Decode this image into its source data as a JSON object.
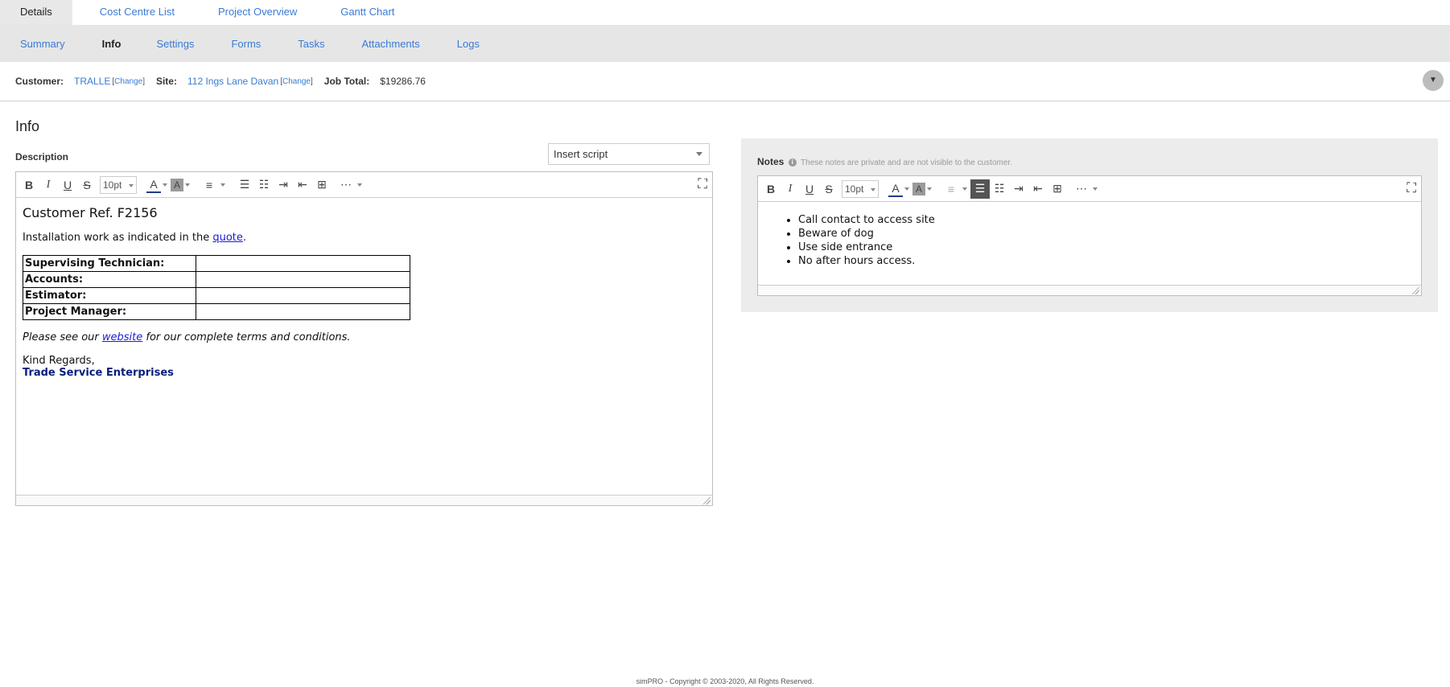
{
  "top_tabs": [
    {
      "label": "Details",
      "active": true
    },
    {
      "label": "Cost Centre List"
    },
    {
      "label": "Project Overview"
    },
    {
      "label": "Gantt Chart"
    }
  ],
  "sub_tabs": [
    {
      "label": "Summary"
    },
    {
      "label": "Info",
      "active": true
    },
    {
      "label": "Settings"
    },
    {
      "label": "Forms"
    },
    {
      "label": "Tasks"
    },
    {
      "label": "Attachments"
    },
    {
      "label": "Logs"
    }
  ],
  "info_strip": {
    "customer_label": "Customer:",
    "customer_value": "TRALLE",
    "change_label": "Change",
    "site_label": "Site:",
    "site_value": "112 Ings Lane Davan",
    "job_total_label": "Job Total:",
    "job_total_value": "$19286.76",
    "collapse_icon": "chevron-down-icon"
  },
  "page_title": "Info",
  "description": {
    "label": "Description",
    "script_select": "Insert script",
    "font_size": "10pt",
    "content": {
      "heading": "Customer Ref. F2156",
      "intro_before": "Installation work as indicated in the ",
      "intro_link": "quote",
      "intro_after": ".",
      "table_rows": [
        "Supervising Technician:",
        "Accounts:",
        "Estimator:",
        "Project Manager:"
      ],
      "terms_before": "Please see our ",
      "terms_link": "website",
      "terms_after": " for our complete terms and conditions.",
      "regards": "Kind Regards,",
      "signature": "Trade Service Enterprises"
    }
  },
  "notes": {
    "label": "Notes",
    "hint": "These notes are private and are not visible to the customer.",
    "font_size": "10pt",
    "items": [
      "Call contact to access site",
      "Beware of dog",
      "Use side entrance",
      "No after hours access."
    ]
  },
  "footer": "simPRO - Copyright © 2003-2020, All Rights Reserved."
}
